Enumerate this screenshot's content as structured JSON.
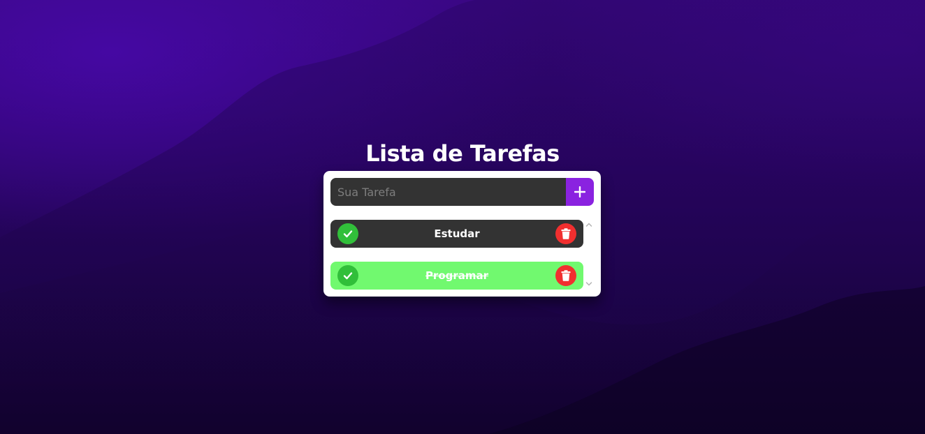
{
  "header": {
    "title": "Lista de Tarefas"
  },
  "input": {
    "placeholder": "Sua Tarefa",
    "value": ""
  },
  "add_button": {
    "icon": "plus-icon"
  },
  "tasks": [
    {
      "label": "Estudar",
      "completed": false
    },
    {
      "label": "Programar",
      "completed": true
    }
  ],
  "colors": {
    "accent": "#8a22e0",
    "check": "#31bf3a",
    "delete": "#f12f2f",
    "pending_bg": "#333333",
    "done_bg": "#71f96f"
  }
}
